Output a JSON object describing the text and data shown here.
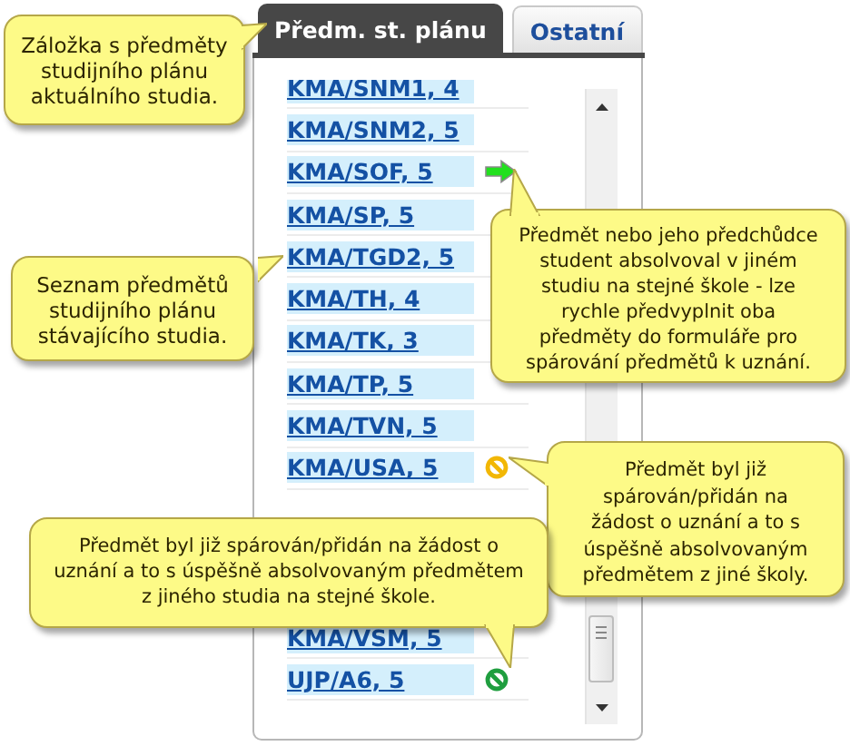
{
  "tabs": [
    {
      "label": "Předm. st. plánu",
      "selected": true
    },
    {
      "label": "Ostatní",
      "selected": false
    }
  ],
  "subjects": [
    {
      "label": "KMA/SNM1, 4",
      "kind": "plain"
    },
    {
      "label": "KMA/SNM2, 5",
      "kind": "plain"
    },
    {
      "label": "KMA/SOF, 5",
      "kind": "prefill"
    },
    {
      "label": "KMA/SP, 5",
      "kind": "plain"
    },
    {
      "label": "KMA/TGD2, 5",
      "kind": "plain"
    },
    {
      "label": "KMA/TH, 4",
      "kind": "plain"
    },
    {
      "label": "KMA/TK, 3",
      "kind": "plain"
    },
    {
      "label": "KMA/TP, 5",
      "kind": "plain"
    },
    {
      "label": "KMA/TVN, 5",
      "kind": "plain"
    },
    {
      "label": "KMA/USA, 5",
      "kind": "external"
    },
    {
      "label": "KMA/VSM, 5",
      "kind": "plain"
    },
    {
      "label": "UJP/A6, 5",
      "kind": "internal"
    }
  ],
  "callouts": [
    {
      "text": "Záložka s předměty studijního plánu aktuálního studia.",
      "kind": "right"
    },
    {
      "text": "Seznam předmětů studijního plánu stávajícího studia.",
      "kind": "right"
    },
    {
      "text": "Předmět nebo jeho předchůdce student absolvoval v jiném studiu na stejné škole - lze rychle předvyplnit oba předměty do formuláře pro spárování předmětů k uznání.",
      "kind": "up"
    },
    {
      "text": "Předmět byl již spárován/přidán na žádost o uznání a to s úspěšně absolvovaným předmětem z jiné školy.",
      "kind": "left"
    },
    {
      "text": "Předmět byl již spárován/přidán na žádost o uznání a to s úspěšně absolvovaným předmětem z jiného studia na stejné škole.",
      "kind": "down"
    }
  ]
}
